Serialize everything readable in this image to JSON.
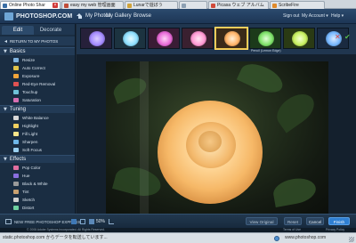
{
  "browser": {
    "tabs": [
      {
        "title": "Online Photo Shar",
        "fav_color": "#3a6ea5",
        "active": true,
        "closable": true
      },
      {
        "title": "easy my web 管理画面",
        "fav_color": "#c14d3a",
        "active": false,
        "closable": false
      },
      {
        "title": "Lunarで遊ぼう",
        "fav_color": "#d0a33a",
        "active": false,
        "closable": false
      },
      {
        "title": "",
        "fav_color": "#8da0b3",
        "active": false,
        "closable": false
      },
      {
        "title": "Picasa ウェブ アルバム",
        "fav_color": "#d14a3a",
        "active": false,
        "closable": false
      },
      {
        "title": "ScribeFire",
        "fav_color": "#e08a2b",
        "active": false,
        "closable": false
      }
    ],
    "status_text": "static.photoshop.com からデータを転送しています...",
    "status_url": "www.photoshop.com"
  },
  "header": {
    "logo_text": "PHOTOSHOP.COM",
    "nav": {
      "my_photos": "My Photos",
      "my_gallery": "My Gallery",
      "browse": "Browse"
    },
    "right": {
      "sign_out": "Sign out",
      "my_account": "My Account ▾",
      "help": "Help ▾"
    }
  },
  "left_panel": {
    "tabs": {
      "edit": "Edit",
      "decorate": "Decorate"
    },
    "return_label": "RETURN TO MY PHOTOS",
    "sections": [
      {
        "title": "Basics",
        "items": [
          "Resize",
          "Auto Correct",
          "Exposure",
          "Red-Eye Removal",
          "Touchup",
          "Saturation"
        ]
      },
      {
        "title": "Tuning",
        "items": [
          "White Balance",
          "Highlight",
          "Fill Light",
          "Sharpen",
          "Soft Focus"
        ]
      },
      {
        "title": "Effects",
        "items": [
          "Pop Color",
          "Hue",
          "Black & White",
          "Tint",
          "Sketch",
          "Distort"
        ]
      }
    ],
    "icon_colors": {
      "basics": [
        "#7fb3e0",
        "#e0c34a",
        "#f2a53a",
        "#e05252",
        "#6fc2d8",
        "#d86fb2"
      ],
      "tuning": [
        "#d8d8d8",
        "#f0d060",
        "#f6e58a",
        "#6fb7e8",
        "#9ad0f0"
      ],
      "effects": [
        "#e06fa0",
        "#8a6fe0",
        "#9a9a9a",
        "#c8a070",
        "#d0d0d0",
        "#6fd0a0"
      ]
    }
  },
  "thumbnails": {
    "caption": "Pencil (Lemon Edge)",
    "items": [
      {
        "name": "violet",
        "color": "#a58cff"
      },
      {
        "name": "cyan",
        "color": "#8fe0ff"
      },
      {
        "name": "magenta",
        "color": "#e86bd8"
      },
      {
        "name": "pink",
        "color": "#ff9ad4"
      },
      {
        "name": "peach",
        "color": "#ffb56a"
      },
      {
        "name": "green",
        "color": "#7fe26a"
      },
      {
        "name": "lime",
        "color": "#c8f060"
      },
      {
        "name": "blue",
        "color": "#78b8ff"
      }
    ],
    "selected_index": 4
  },
  "bottom_bar": {
    "express_label": "NEW FREE PHOTOSHOP EXPRESS",
    "zoom": "50%",
    "buttons": {
      "view_original": "View Original",
      "reset": "Reset",
      "cancel": "Cancel",
      "finish": "Finish"
    }
  },
  "footer": {
    "copyright": "© 2008 Adobe Systems Incorporated. All Rights Reserved.",
    "terms": "Terms of Use",
    "privacy": "Privacy Policy"
  },
  "colors": {
    "accent": "#2f7fd2",
    "selection": "#e8c14d",
    "cancel_x": "#d9433e",
    "apply_check": "#57b94a"
  }
}
